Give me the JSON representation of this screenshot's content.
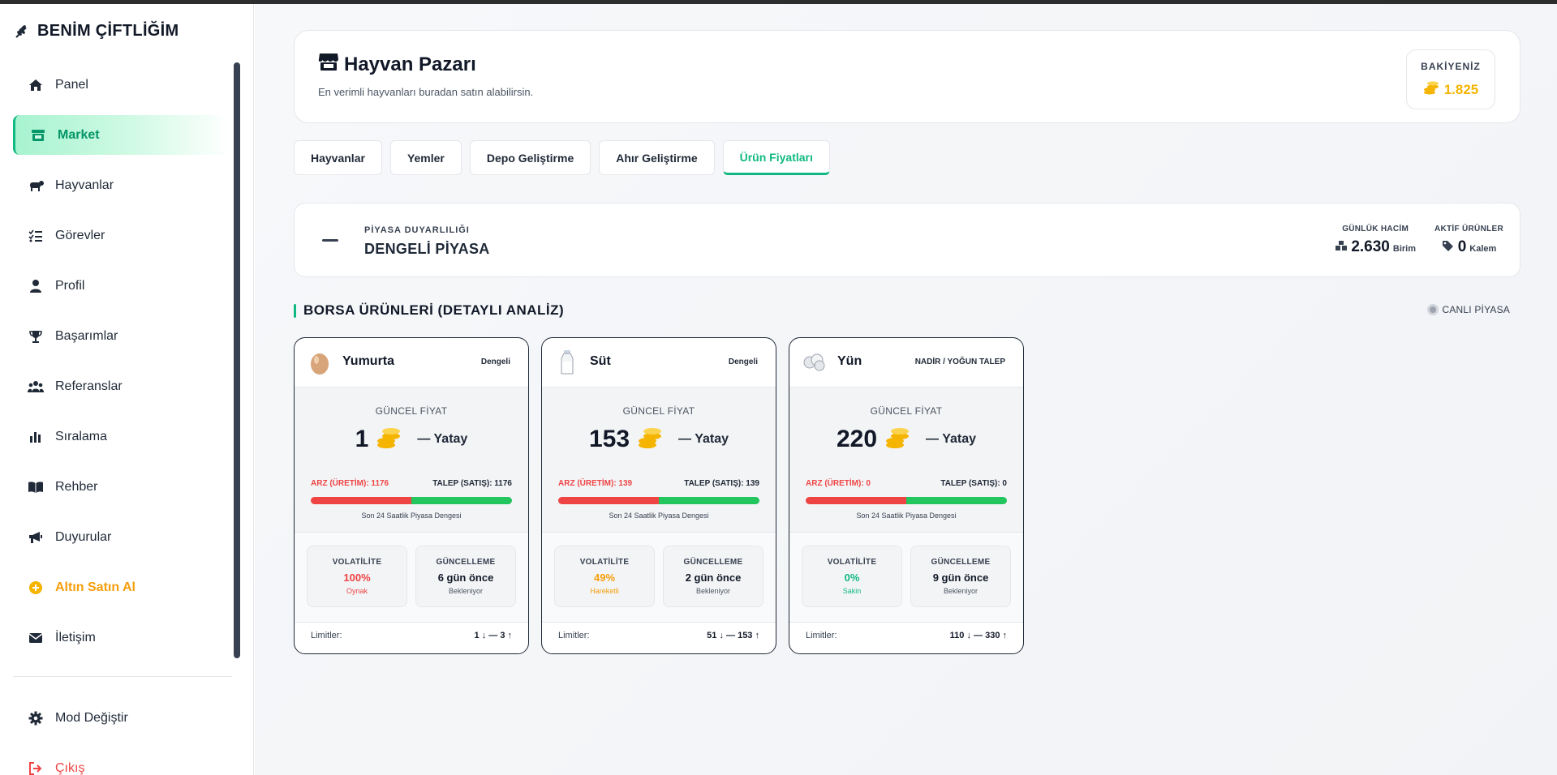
{
  "brand": {
    "title": "BENİM ÇİFTLİĞİM"
  },
  "sidebar": {
    "items": [
      {
        "label": "Panel",
        "icon": "home-icon"
      },
      {
        "label": "Market",
        "icon": "store-icon",
        "active": true
      },
      {
        "label": "Hayvanlar",
        "icon": "cow-icon"
      },
      {
        "label": "Görevler",
        "icon": "tasks-icon"
      },
      {
        "label": "Profil",
        "icon": "user-icon"
      },
      {
        "label": "Başarımlar",
        "icon": "trophy-icon"
      },
      {
        "label": "Referanslar",
        "icon": "users-icon"
      },
      {
        "label": "Sıralama",
        "icon": "chart-bar-icon"
      },
      {
        "label": "Rehber",
        "icon": "book-icon"
      },
      {
        "label": "Duyurular",
        "icon": "megaphone-icon"
      },
      {
        "label": "Altın Satın Al",
        "icon": "coin-plus-icon"
      },
      {
        "label": "İletişim",
        "icon": "envelope-icon"
      }
    ],
    "bottom": [
      {
        "label": "Mod Değiştir",
        "icon": "gear-icon"
      },
      {
        "label": "Çıkış",
        "icon": "logout-icon"
      }
    ]
  },
  "header": {
    "title": "Hayvan Pazarı",
    "subtitle": "En verimli hayvanları buradan satın alabilirsin.",
    "balance_label": "BAKİYENİZ",
    "balance_value": "1.825"
  },
  "tabs": [
    {
      "label": "Hayvanlar"
    },
    {
      "label": "Yemler"
    },
    {
      "label": "Depo Geliştirme"
    },
    {
      "label": "Ahır Geliştirme"
    },
    {
      "label": "Ürün Fiyatları",
      "active": true
    }
  ],
  "sentiment": {
    "label": "PİYASA DUYARLILIĞI",
    "value": "DENGELİ PİYASA",
    "volume_label": "GÜNLÜK HACİM",
    "volume_value": "2.630",
    "volume_unit": "Birim",
    "active_label": "AKTİF ÜRÜNLER",
    "active_value": "0",
    "active_unit": "Kalem"
  },
  "section": {
    "title": "BORSA ÜRÜNLERİ (DETAYLI ANALİZ)",
    "live_label": "CANLI PİYASA"
  },
  "card_labels": {
    "price": "GÜNCEL FİYAT",
    "caption": "Son 24 Saatlik Piyasa Dengesi",
    "volatility": "VOLATİLİTE",
    "update": "GÜNCELLEME",
    "limits": "Limitler:"
  },
  "products": [
    {
      "name": "Yumurta",
      "emoji": "egg-icon",
      "trend_badge": "Dengeli",
      "price": "1",
      "price_trend": "— Yatay",
      "supply": "ARZ (ÜRETİM): 1176",
      "demand": "TALEP (SATIŞ): 1176",
      "supply_share": 0.5,
      "volatility": "100%",
      "volatility_state": "Oynak",
      "volatility_color": "#ef4444",
      "update": "6 gün önce",
      "update_state": "Bekleniyor",
      "limits": "1 ↓ — 3 ↑"
    },
    {
      "name": "Süt",
      "emoji": "milk-bottle-icon",
      "trend_badge": "Dengeli",
      "price": "153",
      "price_trend": "— Yatay",
      "supply": "ARZ (ÜRETİM): 139",
      "demand": "TALEP (SATIŞ): 139",
      "supply_share": 0.5,
      "volatility": "49%",
      "volatility_state": "Hareketli",
      "volatility_color": "#f59e0b",
      "update": "2 gün önce",
      "update_state": "Bekleniyor",
      "limits": "51 ↓ — 153 ↑"
    },
    {
      "name": "Yün",
      "emoji": "wool-icon",
      "trend_badge": "NADİR / YOĞUN TALEP",
      "price": "220",
      "price_trend": "— Yatay",
      "supply": "ARZ (ÜRETİM): 0",
      "demand": "TALEP (SATIŞ): 0",
      "supply_share": 0.5,
      "volatility": "0%",
      "volatility_state": "Sakin",
      "volatility_color": "#10b981",
      "update": "9 gün önce",
      "update_state": "Bekleniyor",
      "limits": "110 ↓ — 330 ↑"
    }
  ],
  "colors": {
    "accent": "#10b981",
    "gold": "#f5b400",
    "danger": "#ef4444"
  }
}
